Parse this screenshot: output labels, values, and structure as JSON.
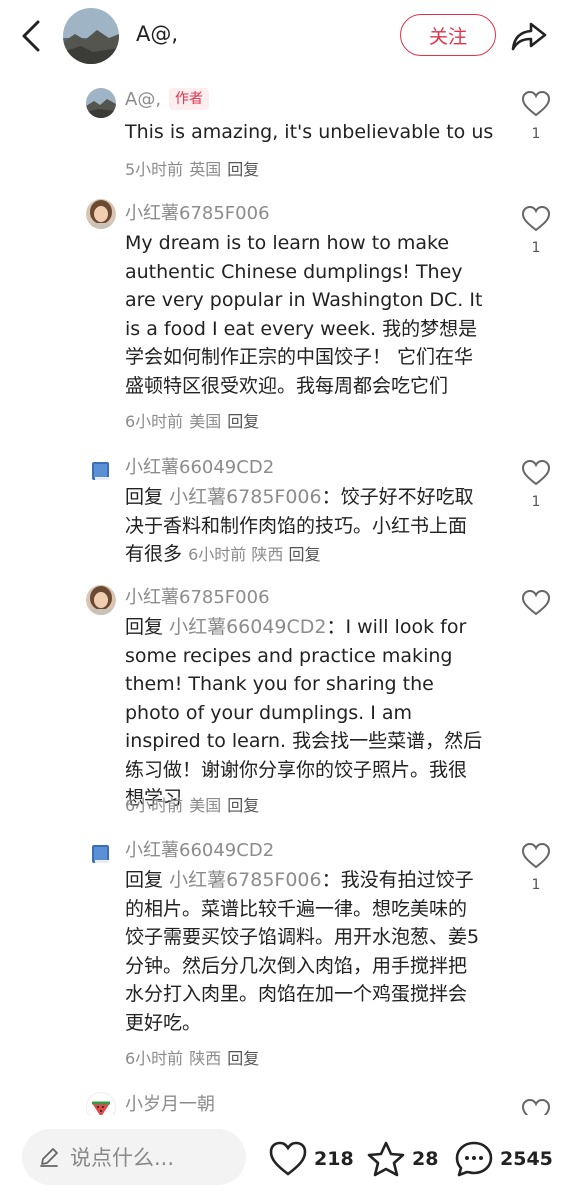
{
  "header": {
    "author_name": "A@,",
    "follow_label": "关注"
  },
  "comments": [
    {
      "name": "A@,",
      "author_tag": "作者",
      "text": "This is amazing, it's unbelievable to us",
      "time": "5小时前",
      "location": "英国",
      "reply_label": "回复",
      "likes": "1"
    },
    {
      "name": "小红薯6785F006",
      "text": "My dream is to learn how to make authentic Chinese dumplings! They are very popular in Washington DC. It is a food I eat every week. 我的梦想是学会如何制作正宗的中国饺子！ 它们在华盛顿特区很受欢迎。我每周都会吃它们",
      "time": "6小时前",
      "location": "美国",
      "reply_label": "回复",
      "likes": "1"
    },
    {
      "name": "小红薯66049CD2",
      "reply_word": "回复",
      "reply_target": "小红薯6785F006",
      "text": "：饺子好不好吃取决于香料和制作肉馅的技巧。小红书上面有很多",
      "time": "6小时前",
      "location": "陕西",
      "reply_label": "回复",
      "likes": "1"
    },
    {
      "name": "小红薯6785F006",
      "reply_word": "回复",
      "reply_target": "小红薯66049CD2",
      "text": "：I will look for some recipes and practice making them! Thank you for sharing the photo of your dumplings. I am inspired to learn. 我会找一些菜谱，然后练习做！谢谢你分享你的饺子照片。我很想学习",
      "time": "6小时前",
      "location": "美国",
      "reply_label": "回复"
    },
    {
      "name": "小红薯66049CD2",
      "reply_word": "回复",
      "reply_target": "小红薯6785F006",
      "text": "：我没有拍过饺子的相片。菜谱比较千遍一律。想吃美味的饺子需要买饺子馅调料。用开水泡葱、姜5分钟。然后分几次倒入肉馅，用手搅拌把水分打入肉里。肉馅在加一个鸡蛋搅拌会更好吃。",
      "time": "6小时前",
      "location": "陕西",
      "reply_label": "回复",
      "likes": "1"
    },
    {
      "name": "小岁月一朝"
    }
  ],
  "bottom_bar": {
    "input_placeholder": "说点什么...",
    "likes": "218",
    "stars": "28",
    "comments": "2545"
  },
  "colors": {
    "accent": "#e0334a",
    "muted_text": "#8c8c8c"
  },
  "icons": [
    "back-arrow-icon",
    "share-icon",
    "heart-icon",
    "book-icon",
    "watermelon-icon",
    "pencil-icon",
    "star-icon",
    "chat-bubble-icon"
  ]
}
